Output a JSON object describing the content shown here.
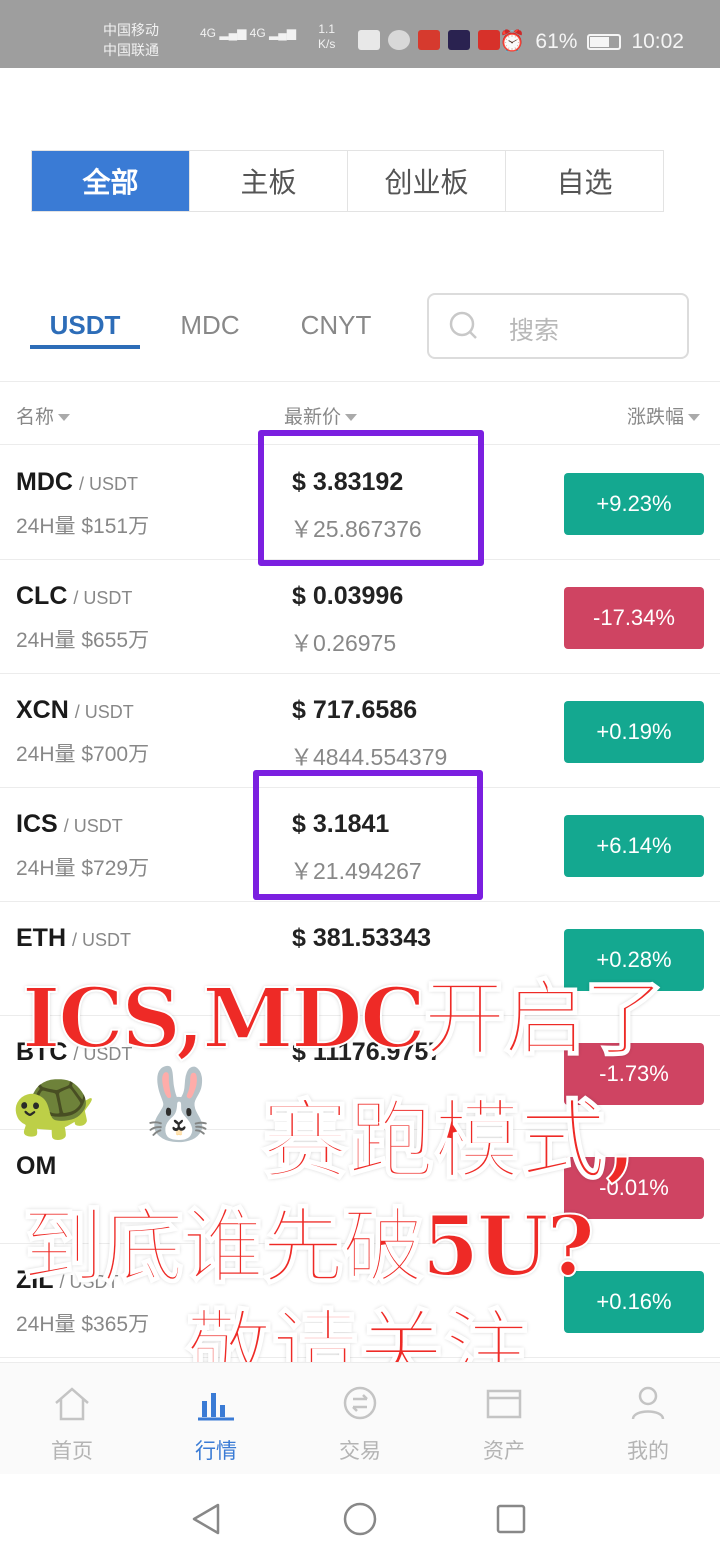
{
  "status_bar": {
    "carrier1": "中国移动",
    "carrier2": "中国联通",
    "hd_badge": "HD",
    "network": "4G",
    "speed_value": "1.1",
    "speed_unit": "K/s",
    "battery": "61%",
    "battery_level": 0.61,
    "time": "10:02"
  },
  "board_tabs": [
    {
      "label": "全部",
      "active": true
    },
    {
      "label": "主板",
      "active": false
    },
    {
      "label": "创业板",
      "active": false
    },
    {
      "label": "自选",
      "active": false
    }
  ],
  "quote_tabs": [
    {
      "label": "USDT",
      "active": true
    },
    {
      "label": "MDC",
      "active": false
    },
    {
      "label": "CNYT",
      "active": false
    }
  ],
  "search": {
    "placeholder": "搜索"
  },
  "list_header": {
    "name": "名称",
    "price": "最新价",
    "change": "涨跌幅"
  },
  "rows": [
    {
      "symbol": "MDC",
      "quote": "/ USDT",
      "volume": "24H量 $151万",
      "price_usd": "$ 3.83192",
      "price_cny": "￥25.867376",
      "change": "+9.23%",
      "direction": "up",
      "highlighted": true
    },
    {
      "symbol": "CLC",
      "quote": "/ USDT",
      "volume": "24H量 $655万",
      "price_usd": "$ 0.03996",
      "price_cny": "￥0.26975",
      "change": "-17.34%",
      "direction": "down",
      "highlighted": false
    },
    {
      "symbol": "XCN",
      "quote": "/ USDT",
      "volume": "24H量 $700万",
      "price_usd": "$ 717.6586",
      "price_cny": "￥4844.554379",
      "change": "+0.19%",
      "direction": "up",
      "highlighted": false
    },
    {
      "symbol": "ICS",
      "quote": "/ USDT",
      "volume": "24H量 $729万",
      "price_usd": "$ 3.1841",
      "price_cny": "￥21.494267",
      "change": "+6.14%",
      "direction": "up",
      "highlighted": true
    },
    {
      "symbol": "ETH",
      "quote": "/ USDT",
      "volume": "",
      "price_usd": "$ 381.53343",
      "price_cny": "",
      "change": "+0.28%",
      "direction": "up",
      "highlighted": false
    },
    {
      "symbol": "BTC",
      "quote": "/ USDT",
      "volume": "",
      "price_usd": "$ 11176.9757",
      "price_cny": "",
      "change": "-1.73%",
      "direction": "down",
      "highlighted": false
    },
    {
      "symbol": "OM",
      "quote": "",
      "volume": "",
      "price_usd": "",
      "price_cny": "",
      "change": "-0.01%",
      "direction": "down",
      "highlighted": false
    },
    {
      "symbol": "ZIL",
      "quote": "/ USDT",
      "volume": "24H量 $365万",
      "price_usd": "",
      "price_cny": "",
      "change": "+0.16%",
      "direction": "up",
      "highlighted": false
    }
  ],
  "overlay": {
    "line1": "ICS,MDC开启了",
    "line2": "赛跑模式,",
    "line3": "到底谁先破5U?",
    "line4": "敬请关注",
    "emoji1": "🐢",
    "emoji2": "🐰"
  },
  "bottom_nav": [
    {
      "label": "首页",
      "icon": "home-icon",
      "active": false
    },
    {
      "label": "行情",
      "icon": "chart-icon",
      "active": true
    },
    {
      "label": "交易",
      "icon": "exchange-icon",
      "active": false
    },
    {
      "label": "资产",
      "icon": "wallet-icon",
      "active": false
    },
    {
      "label": "我的",
      "icon": "user-icon",
      "active": false
    }
  ],
  "colors": {
    "accent": "#3a7bd5",
    "up": "#14a890",
    "down": "#cf4462",
    "highlight_box": "#7b1fe0",
    "overlay_text": "#ee2a26"
  }
}
